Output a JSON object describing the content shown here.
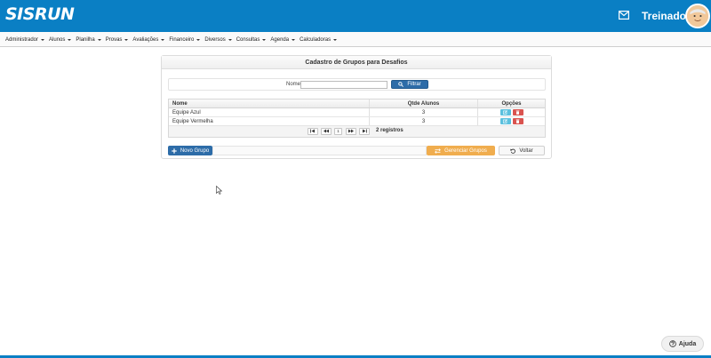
{
  "brand": {
    "logo_text": "SISRUN"
  },
  "header": {
    "user_name": "Treinador",
    "mail_icon": "mail-icon",
    "avatar_icon": "avatar-icon"
  },
  "menu": {
    "items": [
      {
        "label": "Administrador"
      },
      {
        "label": "Alunos"
      },
      {
        "label": "Planilha"
      },
      {
        "label": "Provas"
      },
      {
        "label": "Avaliações"
      },
      {
        "label": "Financeiro"
      },
      {
        "label": "Diversos"
      },
      {
        "label": "Consultas"
      },
      {
        "label": "Agenda"
      },
      {
        "label": "Calculadoras"
      }
    ]
  },
  "panel": {
    "title": "Cadastro de Grupos para Desafios",
    "filter": {
      "label": "Nome",
      "value": "",
      "placeholder": "",
      "button_label": "Filtrar"
    },
    "table": {
      "headers": {
        "name": "Nome",
        "count": "Qtde Alunos",
        "options": "Opções"
      },
      "rows": [
        {
          "name": "Equipe Azul",
          "count": "3"
        },
        {
          "name": "Equipe Vermelha",
          "count": "3"
        }
      ]
    },
    "pager": {
      "current_page": "1",
      "records": "2 registros"
    },
    "actions": {
      "new_group": "Novo Grupo",
      "manage_groups": "Gerenciar Grupos",
      "back": "Voltar"
    }
  },
  "help": {
    "label": "Ajuda"
  },
  "colors": {
    "primary": "#0a7fc4",
    "button_blue": "#2d6ca8",
    "orange": "#f0ad4e",
    "edit": "#5bc0de",
    "delete": "#d9534f"
  }
}
